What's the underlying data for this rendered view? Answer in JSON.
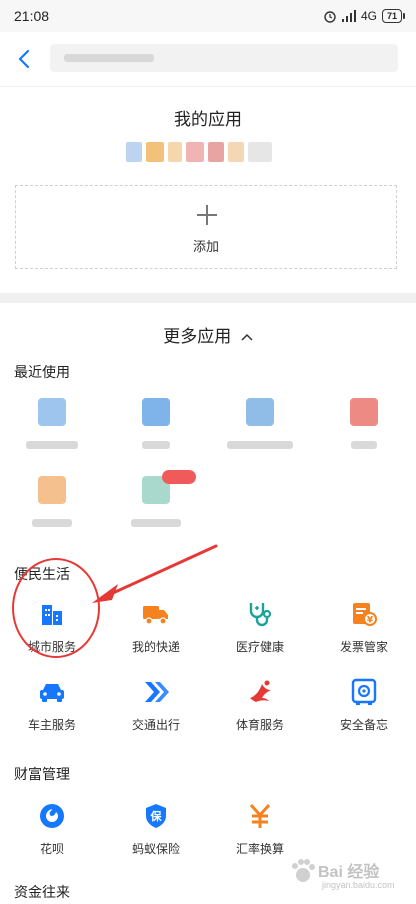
{
  "status_bar": {
    "time": "21:08",
    "network": "4G",
    "battery": "71"
  },
  "my_apps": {
    "title": "我的应用",
    "add_label": "添加"
  },
  "more_apps": {
    "title": "更多应用"
  },
  "recent": {
    "heading": "最近使用"
  },
  "convenience": {
    "heading": "便民生活",
    "items": [
      "城市服务",
      "我的快递",
      "医疗健康",
      "发票管家",
      "车主服务",
      "交通出行",
      "体育服务",
      "安全备忘"
    ]
  },
  "wealth": {
    "heading": "财富管理",
    "items": [
      "花呗",
      "蚂蚁保险",
      "汇率换算"
    ]
  },
  "funds": {
    "heading": "资金往来"
  },
  "watermark": {
    "brand": "Bai  经验",
    "url": "jingyan.baidu.com"
  },
  "colors": {
    "accent_blue": "#1677ff",
    "orange": "#f5821f",
    "teal": "#1aa39a",
    "red": "#e53935"
  }
}
